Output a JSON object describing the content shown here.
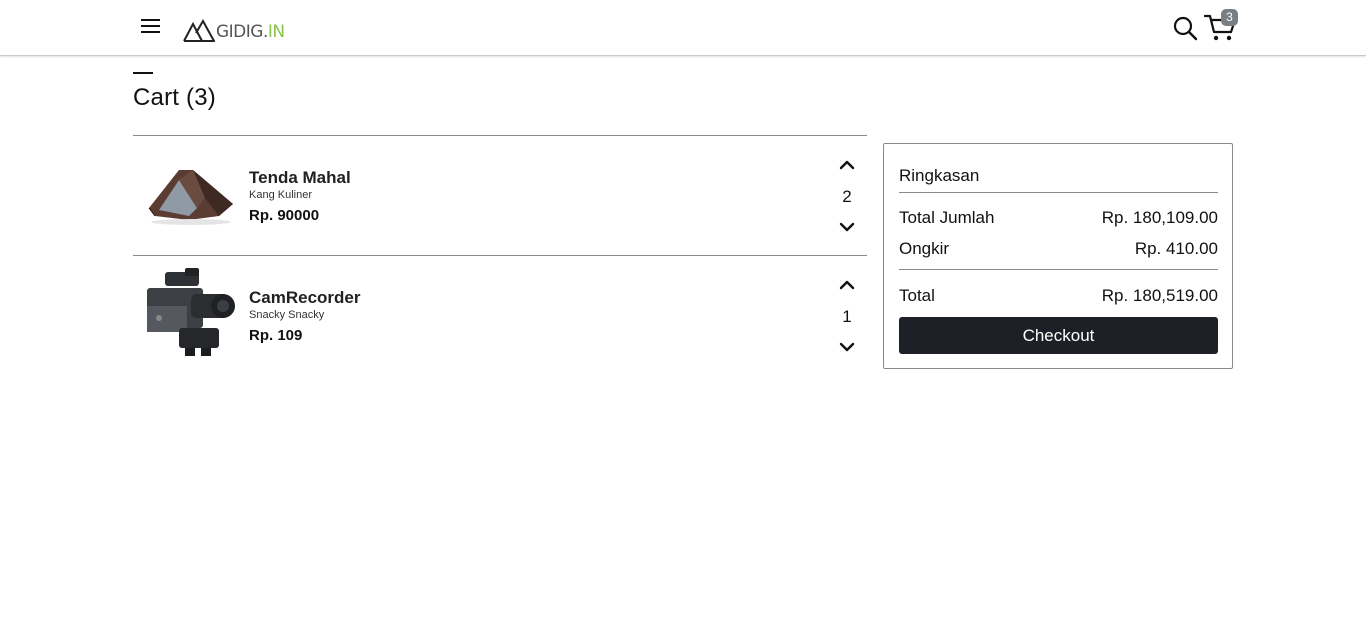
{
  "header": {
    "logo_main": "GIDIG.",
    "logo_accent": "IN",
    "cart_count": "3",
    "accent_color": "#8bc34a"
  },
  "page": {
    "title": "Cart (3)"
  },
  "cart": {
    "items": [
      {
        "name": "Tenda Mahal",
        "vendor": "Kang Kuliner",
        "price": "Rp. 90000",
        "qty": "2"
      },
      {
        "name": "CamRecorder",
        "vendor": "Snacky Snacky",
        "price": "Rp. 109",
        "qty": "1"
      }
    ]
  },
  "summary": {
    "title": "Ringkasan",
    "subtotal_label": "Total Jumlah",
    "subtotal_value": "Rp. 180,109.00",
    "shipping_label": "Ongkir",
    "shipping_value": "Rp. 410.00",
    "total_label": "Total",
    "total_value": "Rp. 180,519.00",
    "checkout_label": "Checkout"
  },
  "icons": [
    "menu-icon",
    "mountain-logo-icon",
    "search-icon",
    "cart-icon",
    "chevron-up-icon",
    "chevron-down-icon"
  ]
}
